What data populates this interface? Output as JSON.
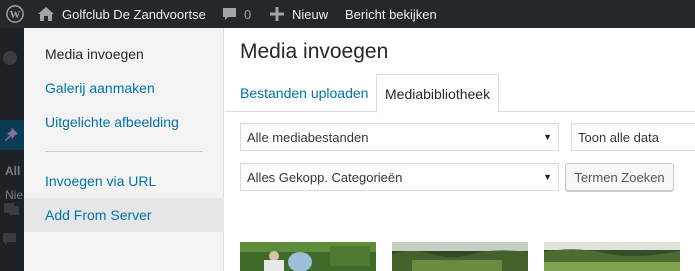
{
  "adminbar": {
    "site_name": "Golfclub De Zandvoortse",
    "comments_count": "0",
    "new_label": "Nieuw",
    "view_post_label": "Bericht bekijken"
  },
  "sidebar_bg": {
    "text_1": "All",
    "text_2": "Nie"
  },
  "menu": {
    "items": [
      {
        "label": "Media invoegen"
      },
      {
        "label": "Galerij aanmaken"
      },
      {
        "label": "Uitgelichte afbeelding"
      },
      {
        "label": "Invoegen via URL"
      },
      {
        "label": "Add From Server"
      }
    ]
  },
  "frame": {
    "title": "Media invoegen",
    "tabs": [
      {
        "label": "Bestanden uploaden"
      },
      {
        "label": "Mediabibliotheek"
      }
    ],
    "filters": {
      "media_type": "Alle mediabestanden",
      "date": "Toon alle data",
      "category": "Alles Gekopp. Categorieën",
      "search_button": "Termen Zoeken"
    }
  },
  "colors": {
    "accent": "#0073aa",
    "adminbar": "#23282d"
  }
}
